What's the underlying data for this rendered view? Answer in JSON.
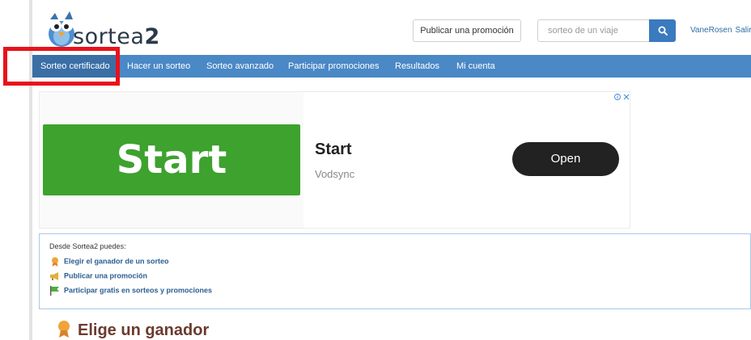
{
  "header": {
    "logo_text_light": "sortea",
    "logo_text_bold": "2",
    "publish_button": "Publicar una promoción",
    "search_placeholder": "sorteo de un viaje",
    "user_name": "VaneRosen",
    "logout": "Salir"
  },
  "nav": {
    "items": [
      {
        "label": "Sorteo certificado",
        "active": true
      },
      {
        "label": "Hacer un sorteo"
      },
      {
        "label": "Sorteo avanzado"
      },
      {
        "label": "Participar promociones"
      },
      {
        "label": "Resultados"
      },
      {
        "label": "Mi cuenta"
      }
    ]
  },
  "ad": {
    "image_text": "Start",
    "title": "Start",
    "advertiser": "Vodsync",
    "cta": "Open"
  },
  "info": {
    "intro": "Desde Sortea2 puedes:",
    "links": [
      {
        "label": "Elegir el ganador de un sorteo",
        "icon": "award-icon"
      },
      {
        "label": "Publicar una promoción",
        "icon": "megaphone-icon"
      },
      {
        "label": "Participar gratis en sorteos y promociones",
        "icon": "flag-icon"
      }
    ]
  },
  "section": {
    "title": "Elige un ganador"
  },
  "colors": {
    "nav_bg": "#4a88c6",
    "highlight": "#e8121b",
    "ad_green": "#3da22e",
    "link": "#2b5e92",
    "heading": "#6b3b2e"
  }
}
